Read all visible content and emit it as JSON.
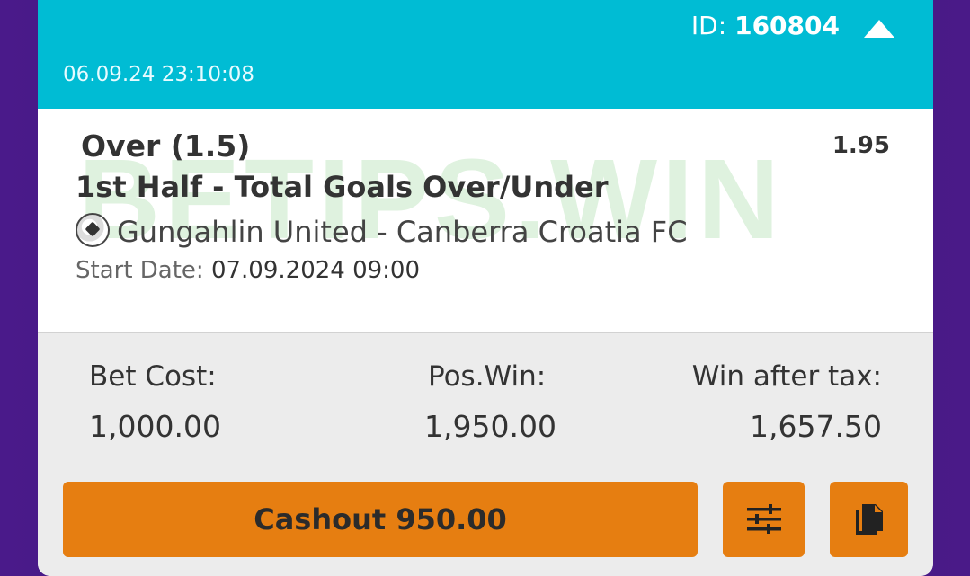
{
  "header": {
    "id_label": "ID:",
    "id_value": "160804",
    "datetime": "06.09.24 23:10:08"
  },
  "selection": {
    "watermark": "BETIPS.WIN",
    "pick": "Over (1.5)",
    "odds": "1.95",
    "market": "1st Half - Total Goals Over/Under",
    "match": "Gungahlin United - Canberra Croatia FC",
    "start_label": "Start Date:",
    "start_value": "07.09.2024 09:00"
  },
  "summary": {
    "bet_cost_label": "Bet Cost:",
    "bet_cost_value": "1,000.00",
    "pos_win_label": "Pos.Win:",
    "pos_win_value": "1,950.00",
    "win_after_tax_label": "Win after tax:",
    "win_after_tax_value": "1,657.50"
  },
  "actions": {
    "cashout_label": "Cashout 950.00",
    "settings_icon": "sliders-icon",
    "copy_icon": "copy-icon"
  },
  "colors": {
    "header_bg": "#00bcd4",
    "button_bg": "#e67e11",
    "footer_bg": "#ececec",
    "page_bg": "#4a1a8a"
  }
}
